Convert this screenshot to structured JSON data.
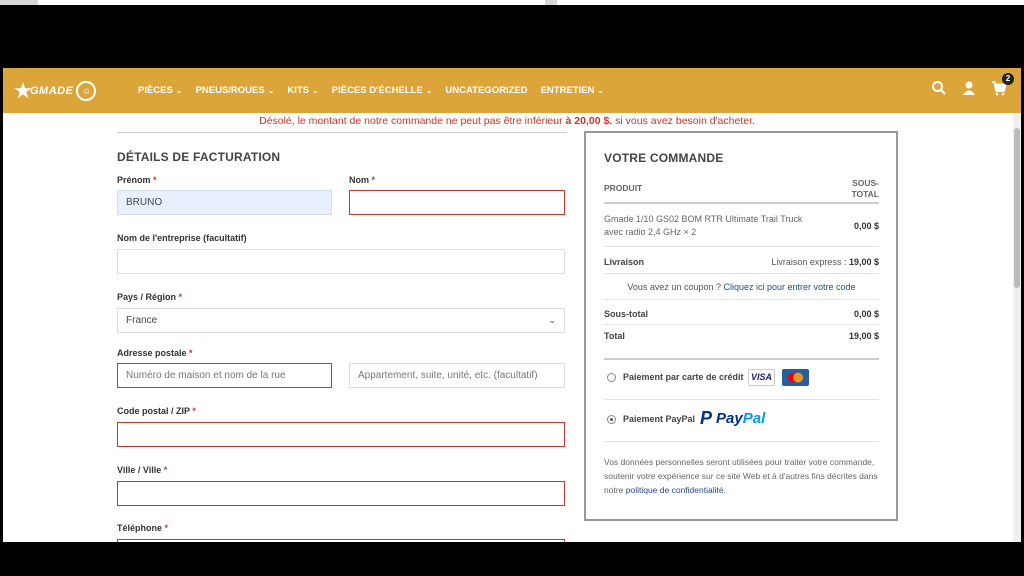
{
  "header": {
    "logo_text": "GMADE",
    "nav": [
      "PIÈCES",
      "PNEUS/ROUES",
      "KITS",
      "PIÈCES D'ÉCHELLE",
      "UNCATEGORIZED",
      "ENTRETIEN"
    ],
    "nav_has_chevron": [
      true,
      true,
      true,
      true,
      false,
      true
    ],
    "cart_count": "2",
    "icons": [
      "search-icon",
      "user-icon",
      "cart-icon"
    ],
    "color": "#dba53a"
  },
  "notice": {
    "before": "Désolé, le montant de notre commande ne peut pas être inférieur",
    "amount": "à 20,00 $.",
    "after": "si vous avez besoin d'acheter."
  },
  "billing": {
    "title": "DÉTAILS DE FACTURATION",
    "firstname_label": "Prénom",
    "firstname_value": "BRUNO",
    "lastname_label": "Nom",
    "company_label": "Nom de l'entreprise (facultatif)",
    "country_label": "Pays / Région",
    "country_value": "France",
    "address_label": "Adresse postale",
    "address_placeholder": "Numéro de maison et nom de la rue",
    "address2_placeholder": "Appartement, suite, unité, etc. (facultatif)",
    "postcode_label": "Code postal / ZIP",
    "city_label": "Ville / Ville",
    "phone_label": "Téléphone",
    "required_mark": "*"
  },
  "order": {
    "title": "VOTRE COMMANDE",
    "col_product": "PRODUIT",
    "col_subtotal_1": "SOUS-",
    "col_subtotal_2": "TOTAL",
    "item_line1": "Gmade 1/10 GS02 BOM RTR Ultimate Trail Truck",
    "item_line2": "avec radio 2,4 GHz × 2",
    "item_price": "0,00 $",
    "shipping_label": "Livraison",
    "shipping_value": "Livraison express :",
    "shipping_price": "19,00 $",
    "coupon_text": "Vous avez un coupon ?",
    "coupon_link": "Cliquez ici pour entrer votre code",
    "subtotal_label": "Sous-total",
    "subtotal_value": "0,00 $",
    "total_label": "Total",
    "total_value": "19,00 $",
    "pay_card_label": "Paiement par carte de crédit",
    "pay_paypal_label": "Paiement PayPal",
    "visa_text": "VISA",
    "paypal_text_1": "Pay",
    "paypal_text_2": "Pal",
    "privacy_1": "Vos données personnelles seront utilisées pour traiter votre commande,",
    "privacy_2": "soutenir votre expérience sur ce site Web et à d'autres fins décrites dans",
    "privacy_3": "notre",
    "privacy_link": "politique de confidentialité."
  }
}
